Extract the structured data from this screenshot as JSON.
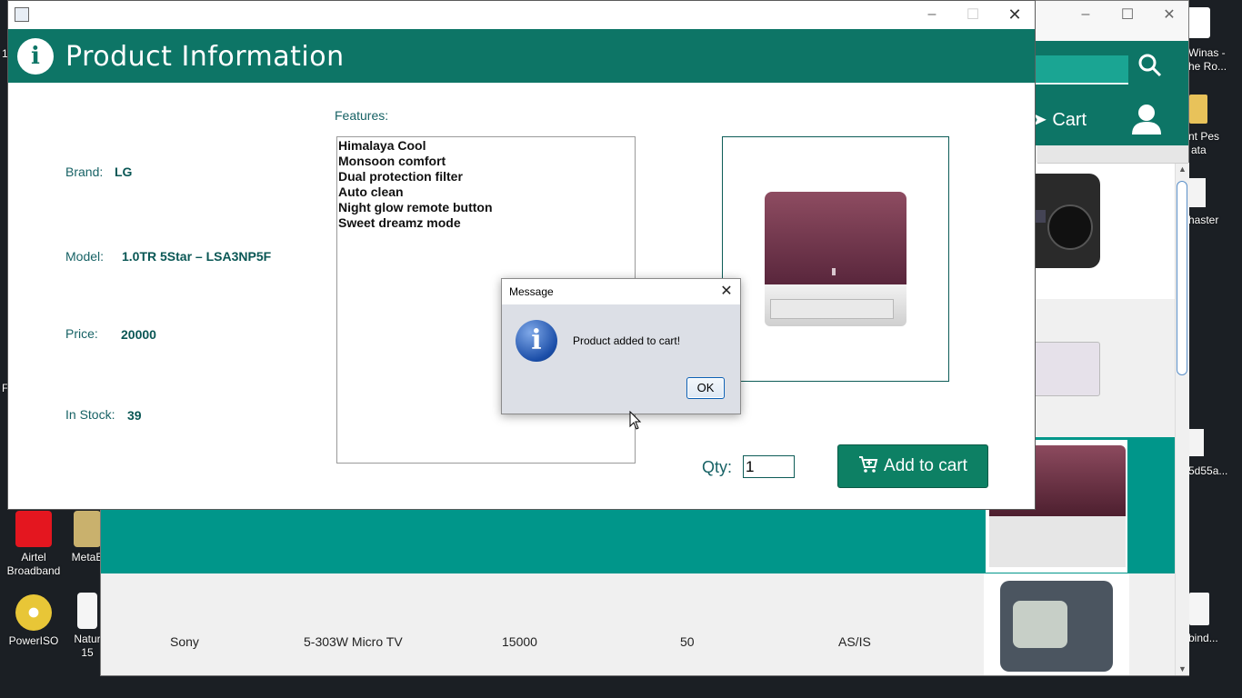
{
  "desktop": {
    "right_icons": [
      "Winas -",
      "he Ro...",
      "nt Pes",
      "ata",
      "haster",
      "5d55a...",
      "bind..."
    ],
    "left_icons": [
      {
        "label": "Airtel Broadband",
        "icon": "airtel-icon"
      },
      {
        "label": "MetaE",
        "icon": "shortcut-icon"
      },
      {
        "label": "PowerISO",
        "icon": "poweriso-icon"
      },
      {
        "label": "Natur 15",
        "icon": "shortcut-icon"
      }
    ],
    "edge_letters": [
      "1",
      "F"
    ]
  },
  "bg_window": {
    "cart_label": "Cart",
    "row": {
      "brand": "Sony",
      "model": "5-303W Micro TV",
      "price": "15000",
      "stock": "50",
      "condition": "AS/IS"
    }
  },
  "product_window": {
    "title": "Product Information",
    "brand_label": "Brand:",
    "brand_value": "LG",
    "model_label": "Model:",
    "model_value": "1.0TR 5Star – LSA3NP5F",
    "price_label": "Price:",
    "price_value": "20000",
    "stock_label": "In Stock:",
    "stock_value": "39",
    "features_label": "Features:",
    "features": [
      "Himalaya Cool",
      "Monsoon comfort",
      "Dual protection filter",
      "Auto clean",
      "Night glow remote button",
      "Sweet dreamz mode"
    ],
    "qty_label": "Qty:",
    "qty_value": "1",
    "add_to_cart_label": "Add to cart"
  },
  "dialog": {
    "title": "Message",
    "message": "Product added to cart!",
    "ok_label": "OK"
  },
  "colors": {
    "teal_dark": "#0d7566",
    "teal": "#00968a",
    "label_teal": "#176265"
  }
}
